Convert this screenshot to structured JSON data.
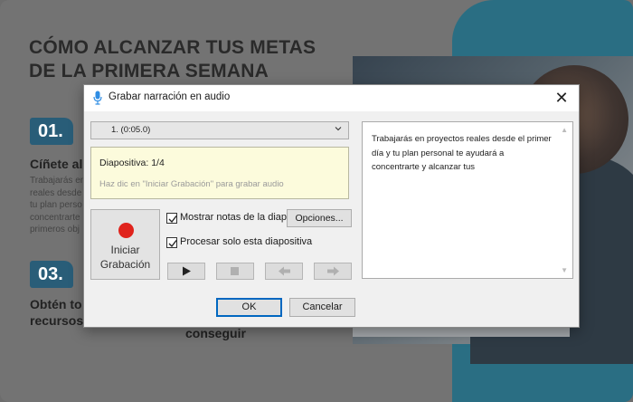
{
  "slide": {
    "title_line1": "CÓMO ALCANZAR TUS METAS",
    "title_line2": "DE LA PRIMERA SEMANA",
    "badge1": "01.",
    "heading1": "Cíñete al",
    "body_lines": [
      "Trabajarás en",
      "reales desde",
      "tu plan perso",
      "concentrarte",
      "primeros obj"
    ],
    "badge2": "03.",
    "heading2_line1": "Obtén to",
    "heading2_line2": "recursos",
    "fragment": "conseguir"
  },
  "dialog": {
    "title": "Grabar narración en audio",
    "close_symbol": "✕",
    "slide_select": "1. (0:05.0)",
    "slide_info": "Diapositiva: 1/4",
    "hint": "Haz dic en \"Iniciar Grabación\" para grabar audio",
    "record_label_line1": "Iniciar",
    "record_label_line2": "Grabación",
    "show_notes_label": "Mostrar notas de la diap",
    "options_label": "Opciones...",
    "process_only_label": "Procesar solo esta diapositiva",
    "notes_text": "Trabajarás en proyectos reales desde el primer día y tu plan personal te ayudará a concentrarte y alcanzar tus",
    "ok_label": "OK",
    "cancel_label": "Cancelar",
    "show_notes_checked": true,
    "process_only_checked": true
  },
  "colors": {
    "badge": "#295d78",
    "teal_panel": "#2a6e83",
    "record_dot": "#e0231c",
    "notes_bg": "#fcfbdc",
    "focus_border": "#0067c0"
  },
  "icons": [
    "microphone-icon",
    "close-icon",
    "chevron-down-icon",
    "record-icon",
    "play-icon",
    "stop-icon",
    "previous-icon",
    "next-icon",
    "checkmark-icon"
  ]
}
